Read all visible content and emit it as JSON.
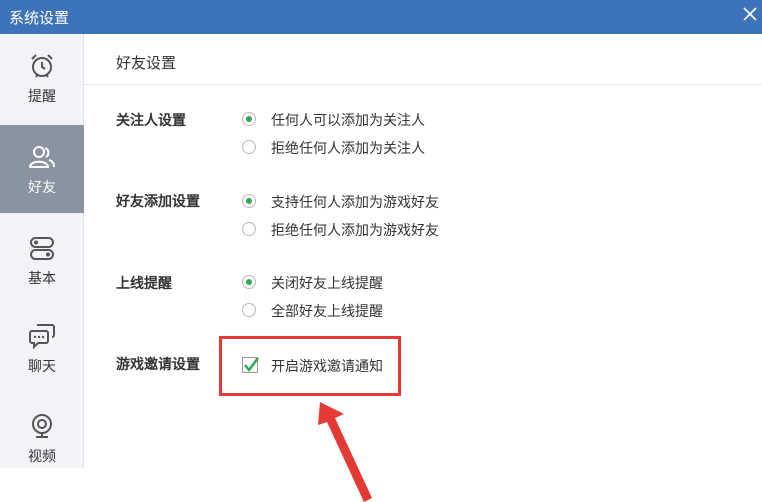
{
  "window": {
    "title": "系统设置",
    "close_icon": "close-icon"
  },
  "sidebar": {
    "items": [
      {
        "label": "提醒",
        "icon": "alarm-clock-icon",
        "active": false
      },
      {
        "label": "好友",
        "icon": "friends-icon",
        "active": true
      },
      {
        "label": "基本",
        "icon": "toggle-settings-icon",
        "active": false
      },
      {
        "label": "聊天",
        "icon": "chat-bubbles-icon",
        "active": false
      },
      {
        "label": "视频",
        "icon": "webcam-icon",
        "active": false
      }
    ]
  },
  "main": {
    "section_title": "好友设置",
    "groups": [
      {
        "label": "关注人设置",
        "options": [
          {
            "text": "任何人可以添加为关注人",
            "selected": true
          },
          {
            "text": "拒绝任何人添加为关注人",
            "selected": false
          }
        ]
      },
      {
        "label": "好友添加设置",
        "options": [
          {
            "text": "支持任何人添加为游戏好友",
            "selected": true
          },
          {
            "text": "拒绝任何人添加为游戏好友",
            "selected": false
          }
        ]
      },
      {
        "label": "上线提醒",
        "options": [
          {
            "text": "关闭好友上线提醒",
            "selected": true
          },
          {
            "text": "全部好友上线提醒",
            "selected": false
          }
        ]
      },
      {
        "label": "游戏邀请设置",
        "checkbox": {
          "text": "开启游戏邀请通知",
          "checked": true
        }
      }
    ]
  },
  "colors": {
    "titlebar": "#3d73b9",
    "sidebar_active": "#8a93a2",
    "radio_selected": "#33a853",
    "annotation": "#e53935"
  }
}
